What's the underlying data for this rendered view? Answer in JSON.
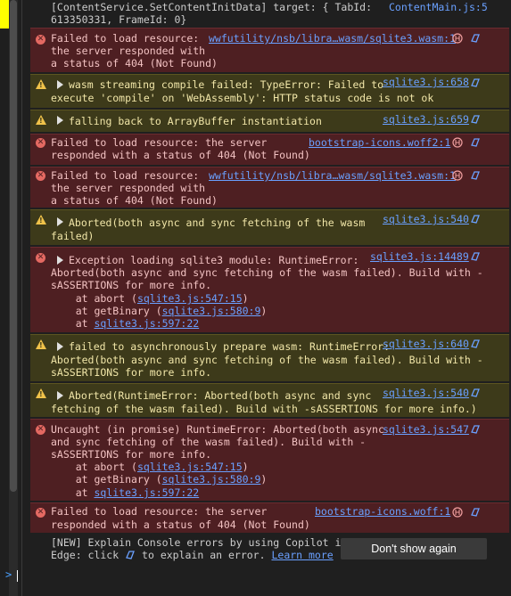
{
  "messages": [
    {
      "lines": [
        "[ContentService.SetContentInitData] target: { TabId:",
        "613350331, FrameId: 0}"
      ],
      "source": "ContentMain.js:5"
    },
    {
      "lines": [
        "Failed to load resource:",
        "the server responded with",
        "a status of 404 (Not Found)"
      ],
      "source": "wwfutility/nsb/libra…wasm/sqlite3.wasm:1"
    },
    {
      "lines": [
        "wasm streaming compile failed: TypeError: Failed to",
        "execute 'compile' on 'WebAssembly': HTTP status code is not ok"
      ],
      "source": "sqlite3.js:658"
    },
    {
      "lines": [
        "falling back to ArrayBuffer instantiation"
      ],
      "source": "sqlite3.js:659"
    },
    {
      "lines": [
        "Failed to load resource: the server",
        "responded with a status of 404 (Not Found)"
      ],
      "source": "bootstrap-icons.woff2:1"
    },
    {
      "lines": [
        "Failed to load resource:",
        "the server responded with",
        "a status of 404 (Not Found)"
      ],
      "source": "wwfutility/nsb/libra…wasm/sqlite3.wasm:1"
    },
    {
      "lines": [
        "Aborted(both async and sync fetching of the wasm",
        "failed)"
      ],
      "source": "sqlite3.js:540"
    },
    {
      "lines": [
        "Exception loading sqlite3 module: RuntimeError:",
        "Aborted(both async and sync fetching of the wasm failed). Build with -",
        "sASSERTIONS for more info."
      ],
      "source": "sqlite3.js:14489",
      "stack": [
        {
          "fn": "    at abort (",
          "link": "sqlite3.js:547:15",
          "end": ")"
        },
        {
          "fn": "    at getBinary (",
          "link": "sqlite3.js:580:9",
          "end": ")"
        },
        {
          "fn": "    at ",
          "link": "sqlite3.js:597:22",
          "end": ""
        }
      ]
    },
    {
      "lines": [
        "failed to asynchronously prepare wasm: RuntimeError:",
        "Aborted(both async and sync fetching of the wasm failed). Build with -",
        "sASSERTIONS for more info."
      ],
      "source": "sqlite3.js:640"
    },
    {
      "lines": [
        "Aborted(RuntimeError: Aborted(both async and sync",
        "fetching of the wasm failed). Build with -sASSERTIONS for more info.)"
      ],
      "source": "sqlite3.js:540"
    },
    {
      "lines": [
        "Uncaught (in promise) RuntimeError: Aborted(both async",
        "and sync fetching of the wasm failed). Build with -",
        "sASSERTIONS for more info."
      ],
      "source": "sqlite3.js:547",
      "stack": [
        {
          "fn": "    at abort (",
          "link": "sqlite3.js:547:15",
          "end": ")"
        },
        {
          "fn": "    at getBinary (",
          "link": "sqlite3.js:580:9",
          "end": ")"
        },
        {
          "fn": "    at ",
          "link": "sqlite3.js:597:22",
          "end": ""
        }
      ]
    },
    {
      "lines": [
        "Failed to load resource: the server",
        "responded with a status of 404 (Not Found)"
      ],
      "source": "bootstrap-icons.woff:1"
    }
  ],
  "copilot": {
    "line1": "[NEW] Explain Console errors by using Copilot in",
    "line2_pre": "Edge: click",
    "line2_post": "to explain an error.",
    "learn_more": "Learn more",
    "dont_show": "Don't show again"
  },
  "prompt_symbol": ">",
  "icons": {
    "error": "error-circle-icon",
    "warning": "warning-triangle-icon",
    "tool": "copilot-explain-icon",
    "network": "network-request-icon"
  },
  "colors": {
    "error_bg": "#4e1f22",
    "warning_bg": "#3d3a1a",
    "link": "#6aa0ff",
    "background": "#1f1f1f"
  }
}
